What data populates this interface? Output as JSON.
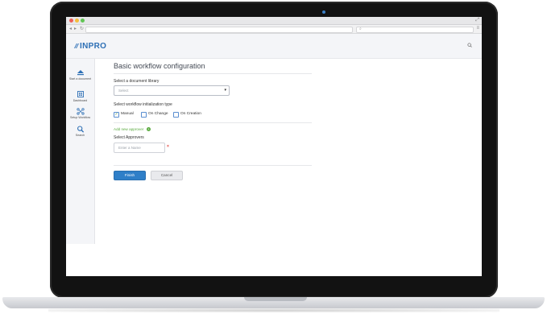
{
  "app": {
    "logo": "INPRO",
    "brand_color": "#2d6fb5",
    "accent_green": "#5aaa3f",
    "danger_color": "#e0413b"
  },
  "browser": {
    "expand_icon": "expand-icon",
    "back_glyph": "◂",
    "forward_glyph": "▸",
    "reload_glyph": "↻",
    "search_glyph": "⌕",
    "menu_glyph": "≡",
    "address_value": "",
    "search_value": ""
  },
  "sidebar": {
    "items": [
      {
        "label": "Start a document",
        "icon": "start-document-icon"
      },
      {
        "label": "Dashboard",
        "icon": "dashboard-icon"
      },
      {
        "label": "Setup Workflow",
        "icon": "workflow-icon"
      },
      {
        "label": "Search",
        "icon": "search-icon"
      }
    ]
  },
  "page": {
    "title": "Basic workflow configuration"
  },
  "library": {
    "label": "Select a document library",
    "selected": "Select"
  },
  "init_type": {
    "label": "Select workflow initialization type",
    "options": [
      {
        "label": "Manual",
        "checked": true
      },
      {
        "label": "On Change",
        "checked": false
      },
      {
        "label": "On Creation",
        "checked": false
      }
    ]
  },
  "approvers": {
    "add_link": "Add new approver",
    "label": "Select Approvers",
    "input_placeholder": "Enter a Name",
    "remove_glyph": "×"
  },
  "actions": {
    "finish": "Finish",
    "cancel": "Cancel"
  }
}
